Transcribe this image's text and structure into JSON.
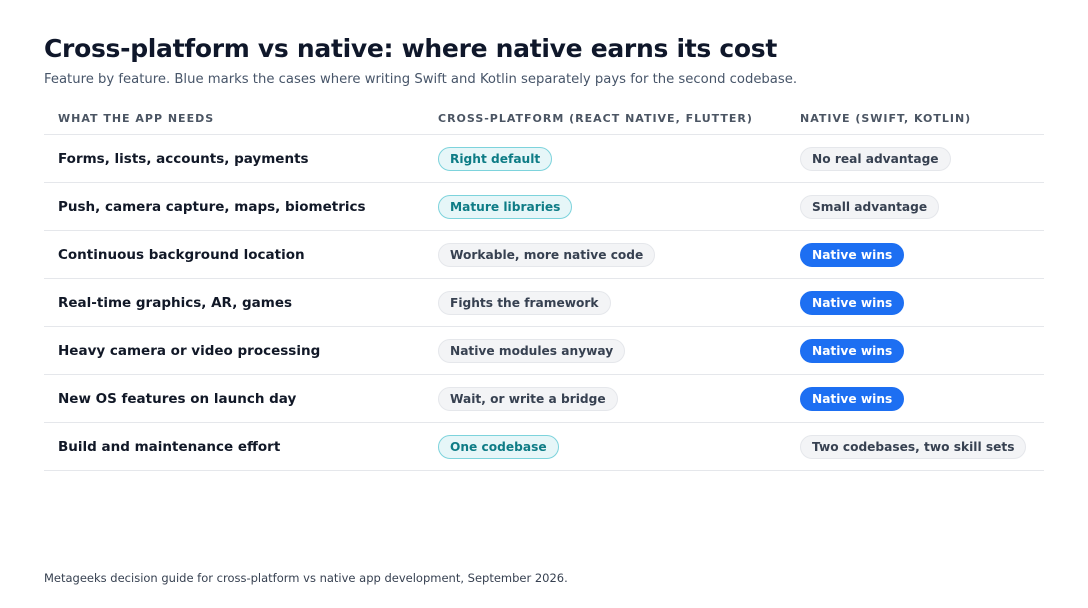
{
  "title": "Cross-platform vs native: where native earns its cost",
  "subtitle": "Feature by feature. Blue marks the cases where writing Swift and Kotlin separately pays for the second codebase.",
  "columns": {
    "need": "WHAT THE APP NEEDS",
    "cross": "CROSS-PLATFORM (REACT NATIVE, FLUTTER)",
    "native": "NATIVE (SWIFT, KOTLIN)"
  },
  "rows": [
    {
      "need": "Forms, lists, accounts, payments",
      "cross": {
        "text": "Right default",
        "tone": "teal"
      },
      "native": {
        "text": "No real advantage",
        "tone": "gray"
      }
    },
    {
      "need": "Push, camera capture, maps, biometrics",
      "cross": {
        "text": "Mature libraries",
        "tone": "teal"
      },
      "native": {
        "text": "Small advantage",
        "tone": "gray"
      }
    },
    {
      "need": "Continuous background location",
      "cross": {
        "text": "Workable, more native code",
        "tone": "gray"
      },
      "native": {
        "text": "Native wins",
        "tone": "blue"
      }
    },
    {
      "need": "Real-time graphics, AR, games",
      "cross": {
        "text": "Fights the framework",
        "tone": "gray"
      },
      "native": {
        "text": "Native wins",
        "tone": "blue"
      }
    },
    {
      "need": "Heavy camera or video processing",
      "cross": {
        "text": "Native modules anyway",
        "tone": "gray"
      },
      "native": {
        "text": "Native wins",
        "tone": "blue"
      }
    },
    {
      "need": "New OS features on launch day",
      "cross": {
        "text": "Wait, or write a bridge",
        "tone": "gray"
      },
      "native": {
        "text": "Native wins",
        "tone": "blue"
      }
    },
    {
      "need": "Build and maintenance effort",
      "cross": {
        "text": "One codebase",
        "tone": "teal"
      },
      "native": {
        "text": "Two codebases, two skill sets",
        "tone": "gray"
      }
    }
  ],
  "footer": "Metageeks decision guide for cross-platform vs native app development, September 2026.",
  "colors": {
    "accent_blue": "#1d6ff2",
    "teal_text": "#0e7c86",
    "teal_bg": "#e6f6f8",
    "gray_bg": "#f3f4f6"
  }
}
